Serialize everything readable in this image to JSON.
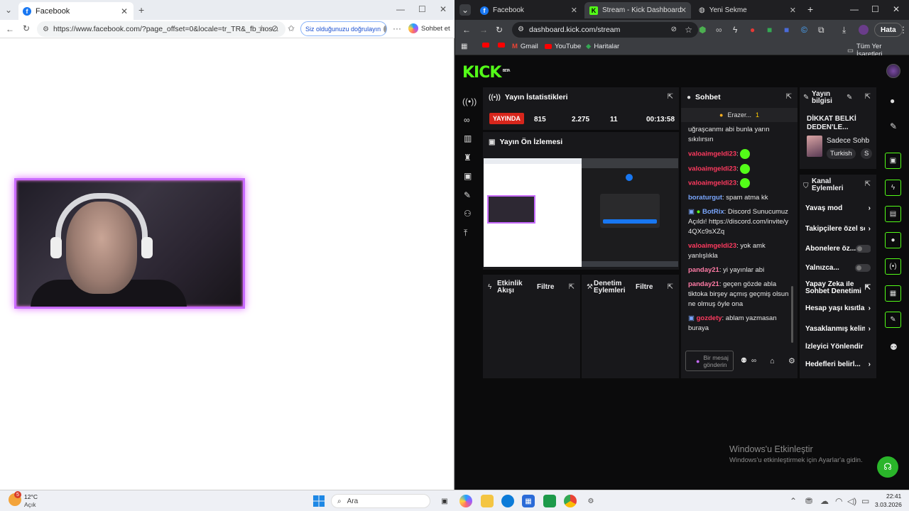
{
  "left_browser": {
    "tab_title": "Facebook",
    "url": "https://www.facebook.com/?page_offset=0&locale=tr_TR&_fb_nos...",
    "verify_pill": "Siz olduğunuzu doğrulayın",
    "chat_label": "Sohbet et"
  },
  "right_browser": {
    "tabs": [
      {
        "title": "Facebook"
      },
      {
        "title": "Stream - Kick Dashboard"
      },
      {
        "title": "Yeni Sekme"
      }
    ],
    "url": "dashboard.kick.com/stream",
    "error_label": "Hata",
    "bookmarks": {
      "gmail": "Gmail",
      "youtube": "YouTube",
      "maps": "Haritalar",
      "all": "Tüm Yer İşaretleri"
    }
  },
  "kick": {
    "logo": "KICK",
    "logo_sup": "BETA",
    "stats": {
      "title": "Yayın İstatistikleri",
      "live": "YAYINDA",
      "viewers": "815",
      "followers": "2.275",
      "subs": "11",
      "duration": "00:13:58"
    },
    "preview": {
      "title": "Yayın Ön İzlemesi"
    },
    "activity": {
      "title": "Etkinlik Akışı",
      "filter": "Filtre"
    },
    "moderation": {
      "title": "Denetim Eylemleri",
      "filter": "Filtre"
    },
    "chat": {
      "title": "Sohbet",
      "pinned_user": "Erazer...",
      "pinned_count": "1",
      "messages": [
        {
          "user": "",
          "text": "uğraşcanmı abi bunla yarın sıkılırsın"
        },
        {
          "user": "valoaimgeldi23",
          "text": ":"
        },
        {
          "user": "valoaimgeldi23",
          "text": ":"
        },
        {
          "user": "valoaimgeldi23",
          "text": ":"
        },
        {
          "user": "boraturgut",
          "text": ": spam atma kk"
        },
        {
          "user": "BotRix",
          "text": ": Discord Sunucumuz Açıldı! https://discord.com/invite/y4QXc9sXZq"
        },
        {
          "user": "valoaimgeldi23",
          "text": ": yok amk yanlışlıkla"
        },
        {
          "user": "panday21",
          "text": ": yi yayınlar abi"
        },
        {
          "user": "panday21",
          "text": ": geçen gözde abla tiktoka birşey açmış geçmiş olsun ne olmuş öyle ona"
        },
        {
          "user": "gozdety",
          "text": ": ablam yazmasan buraya"
        }
      ],
      "input_placeholder": "Bir mesaj gönderin"
    },
    "info": {
      "title": "Yayın bilgisi",
      "stream_title": "DİKKAT BELKİ DEDEN'LE...",
      "category": "Sadece Sohb",
      "tag_lang": "Turkish",
      "tag_more": "S"
    },
    "actions": {
      "title": "Kanal Eylemleri",
      "items": [
        {
          "label": "Yavaş mod"
        },
        {
          "label": "Takipçilere özel so"
        },
        {
          "label": "Abonelere öz..."
        },
        {
          "label": "Yalnızca..."
        },
        {
          "label": "Yapay Zeka ile Sohbet Denetimi"
        },
        {
          "label": "Hesap yaşı kısıtla"
        },
        {
          "label": "Yasaklanmış kelim"
        },
        {
          "label": "İzleyici Yönlendir"
        },
        {
          "label": "Hedefleri belirl..."
        }
      ]
    }
  },
  "watermark": {
    "line1": "Windows'u Etkinleştir",
    "line2": "Windows'u etkinleştirmek için Ayarlar'a gidin."
  },
  "taskbar": {
    "temp": "12°C",
    "weather": "Açık",
    "search": "Ara",
    "time": "22:41",
    "date": "3.03.2026",
    "badge": "5"
  },
  "colors": {
    "kick_green": "#53fc18",
    "live_red": "#d7261c"
  }
}
